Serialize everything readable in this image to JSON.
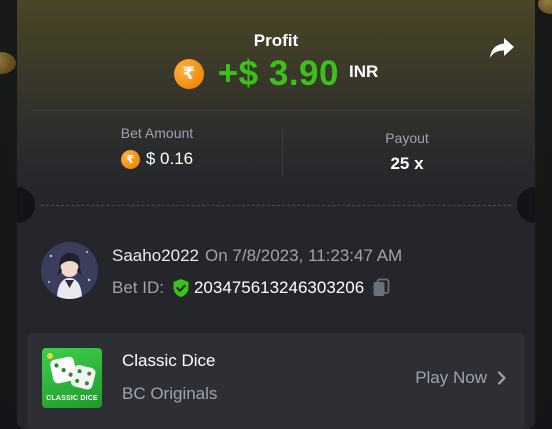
{
  "header": {
    "profit_label": "Profit",
    "profit_amount": "+$ 3.90",
    "profit_currency": "INR",
    "coin_symbol": "₹",
    "icons": {
      "share": "share-arrow-icon",
      "coin": "rupee-coin-icon"
    }
  },
  "stats": {
    "bet_amount_label": "Bet Amount",
    "bet_amount_value": "$ 0.16",
    "payout_label": "Payout",
    "payout_value": "25 x"
  },
  "bet": {
    "username": "Saaho2022",
    "datetime": "On 7/8/2023, 11:23:47 AM",
    "bet_id_label": "Bet ID:",
    "bet_id_value": "203475613246303206",
    "icons": {
      "verified": "verified-shield-icon",
      "copy": "copy-icon"
    }
  },
  "game": {
    "name": "Classic Dice",
    "provider": "BC Originals",
    "thumb_text": "CLASSIC DICE",
    "play_label": "Play Now",
    "icons": {
      "dice": "dice-icon",
      "chevron": "chevron-right-icon"
    }
  },
  "colors": {
    "profit_green": "#3bc117",
    "coin_orange": "#f08a0c",
    "card_bg": "#24262b",
    "muted_text": "#9ea3ad",
    "verified_green": "#3bc117"
  }
}
